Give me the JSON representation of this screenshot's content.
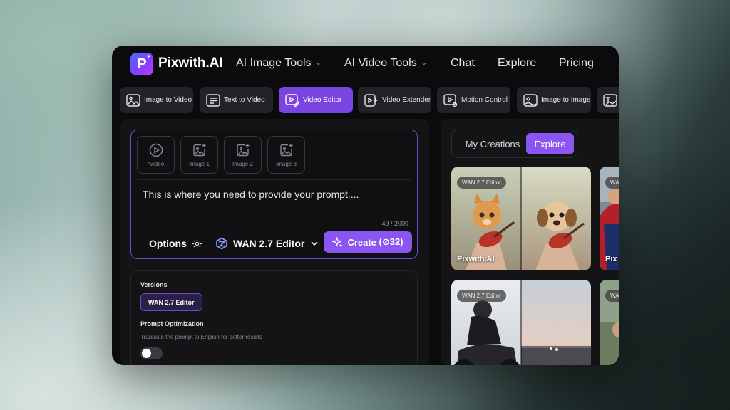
{
  "brand": {
    "name": "Pixwith.AI",
    "logo_letter": "P"
  },
  "nav": [
    {
      "label": "AI Image Tools",
      "dropdown": true
    },
    {
      "label": "AI Video Tools",
      "dropdown": true
    },
    {
      "label": "Chat"
    },
    {
      "label": "Explore"
    },
    {
      "label": "Pricing"
    }
  ],
  "tools": [
    {
      "label": "Image to Video",
      "icon": "image-icon"
    },
    {
      "label": "Text to Video",
      "icon": "text-doc-icon"
    },
    {
      "label": "Video Editor",
      "icon": "video-edit-icon",
      "active": true
    },
    {
      "label": "Video Extender",
      "icon": "video-extend-icon"
    },
    {
      "label": "Motion Control",
      "icon": "motion-icon"
    },
    {
      "label": "Image to Image",
      "icon": "images-icon"
    }
  ],
  "upload_slots": [
    {
      "label": "Video",
      "required_mark": "*",
      "icon": "play-icon"
    },
    {
      "label": "Image 1",
      "icon": "add-image-icon"
    },
    {
      "label": "Image 2",
      "icon": "add-image-icon"
    },
    {
      "label": "Image 3",
      "icon": "add-image-icon"
    }
  ],
  "prompt": {
    "text": "This is where you need to provide your prompt....",
    "counter": "49 / 2000"
  },
  "options_label": "Options",
  "model_label": "WAN 2.7 Editor",
  "create": {
    "label": "Create",
    "credits": "(⊘32)"
  },
  "settings": {
    "versions_title": "Versions",
    "version_value": "WAN 2.7 Editor",
    "opt_title": "Prompt Optimization",
    "opt_desc": "Translate the prompt to English for better results",
    "opt_enabled": false
  },
  "right_tabs": [
    {
      "label": "My Creations"
    },
    {
      "label": "Explore",
      "active": true
    }
  ],
  "cards": [
    {
      "badge": "WAN 2.7 Editor",
      "caption": "Pixwith.AI"
    },
    {
      "badge": "WAN",
      "caption": "Pix"
    },
    {
      "badge": "WAN 2.7 Editor",
      "caption": ""
    },
    {
      "badge": "WA",
      "caption": ""
    }
  ],
  "colors": {
    "accent": "#8a55f0",
    "active_tool": "#7a44e0",
    "frame_bg": "#0b0b0d",
    "panel_bg": "#141417"
  }
}
